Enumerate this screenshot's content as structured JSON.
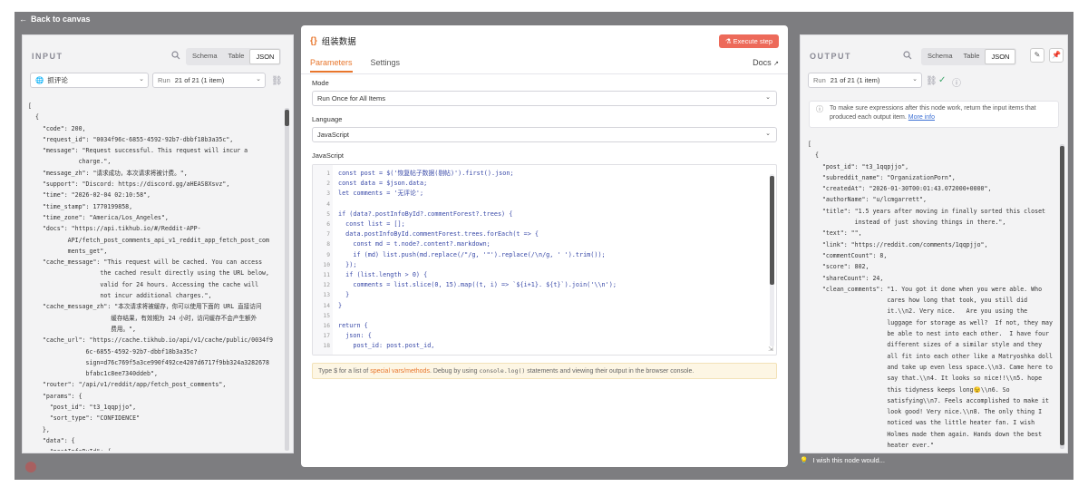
{
  "topbar": {
    "back_label": "Back to canvas",
    "back_icon": "arrow-left-icon"
  },
  "input_panel": {
    "header": "INPUT",
    "view_tabs": [
      "Schema",
      "Table",
      "JSON"
    ],
    "active_tab": "JSON",
    "node_select": "抓评论",
    "run_label": "Run",
    "run_select": "21 of 21 (1 item)",
    "code_lines": [
      "[",
      "  {",
      "    \"code\": 200,",
      "    \"request_id\": \"0034f96c-6855-4592-92b7-dbbf18b3a35c\",",
      "    \"message\": \"Request successful. This request will incur a",
      "              charge.\",",
      "    \"message_zh\": \"请求成功，本次请求将被计费。\",",
      "    \"support\": \"Discord: https://discord.gg/aHEAS8Xsvz\",",
      "    \"time\": \"2026-02-04 02:10:58\",",
      "    \"time_stamp\": 1770199858,",
      "    \"time_zone\": \"America/Los_Angeles\",",
      "    \"docs\": \"https://api.tikhub.io/#/Reddit-APP-",
      "           API/fetch_post_comments_api_v1_reddit_app_fetch_post_com",
      "           ments_get\",",
      "    \"cache_message\": \"This request will be cached. You can access",
      "                    the cached result directly using the URL below,",
      "                    valid for 24 hours. Accessing the cache will",
      "                    not incur additional charges.\",",
      "    \"cache_message_zh\": \"本次请求将被缓存，你可以使用下面的 URL 直接访问",
      "                       缓存结果，有效期为 24 小时，访问缓存不会产生额外",
      "                       费用。\",",
      "    \"cache_url\": \"https://cache.tikhub.io/api/v1/cache/public/0034f9",
      "                6c-6855-4592-92b7-dbbf18b3a35c?",
      "                sign=d76c769f5a3ce990f492ce4207d6717f9bb324a3282678",
      "                bfabc1c8ee7340ddeb\",",
      "    \"router\": \"/api/v1/reddit/app/fetch_post_comments\",",
      "    \"params\": {",
      "      \"post_id\": \"t3_1qqpjjo\",",
      "      \"sort_type\": \"CONFIDENCE\"",
      "    },",
      "    \"data\": {",
      "      \"postInfoById\": {"
    ]
  },
  "editor_panel": {
    "title": "组装数据",
    "execute_label": "Execute step",
    "tabs": [
      "Parameters",
      "Settings"
    ],
    "active_tab": "Parameters",
    "docs_label": "Docs",
    "mode_label": "Mode",
    "mode_value": "Run Once for All Items",
    "language_label": "Language",
    "language_value": "JavaScript",
    "code_label": "JavaScript",
    "line_numbers": [
      "1",
      "2",
      "3",
      "4",
      "5",
      "6",
      "7",
      "8",
      "9",
      "10",
      "11",
      "12",
      "13",
      "14",
      "15",
      "16",
      "17",
      "18"
    ],
    "code_lines": [
      "const post = $('恢复帖子数据(剔帖)').first().json;",
      "const data = $json.data;",
      "let comments = '无评论';",
      "",
      "if (data?.postInfoById?.commentForest?.trees) {",
      "  const list = [];",
      "  data.postInfoById.commentForest.trees.forEach(t => {",
      "    const md = t.node?.content?.markdown;",
      "    if (md) list.push(md.replace(/\"/g, '\"').replace(/\\n/g, ' ').trim());",
      "  });",
      "  if (list.length > 0) {",
      "    comments = list.slice(0, 15).map((t, i) => `${i+1}. ${t}`).join('\\\\n');",
      "  }",
      "}",
      "",
      "return {",
      "  json: {",
      "    post_id: post.post_id,"
    ],
    "hint_prefix": "Type $ for a list of ",
    "hint_link": "special vars/methods",
    "hint_mid": ". Debug by using ",
    "hint_code": "console.log()",
    "hint_suffix": " statements and viewing their output in the browser console."
  },
  "output_panel": {
    "header": "OUTPUT",
    "view_tabs": [
      "Schema",
      "Table",
      "JSON"
    ],
    "active_tab": "JSON",
    "run_label": "Run",
    "run_select": "21 of 21 (1 item)",
    "info_text": "To make sure expressions after this node work, return the input items that produced each output item.",
    "info_link": "More info",
    "code_lines": [
      "[",
      "  {",
      "    \"post_id\": \"t3_1qqpjjo\",",
      "    \"subreddit_name\": \"OrganizationPorn\",",
      "    \"createdAt\": \"2026-01-30T00:01:43.072000+0000\",",
      "    \"authorName\": \"u/lcmgarrett\",",
      "    \"title\": \"1.5 years after moving in finally sorted this closet",
      "             instead of just shoving things in there.\",",
      "    \"text\": \"\",",
      "    \"link\": \"https://reddit.com/comments/1qqpjjo\",",
      "    \"commentCount\": 8,",
      "    \"score\": 802,",
      "    \"shareCount\": 24,",
      "    \"clean_comments\": \"1. You got it done when you were able. Who",
      "                      cares how long that took, you still did",
      "                      it.\\\\n2. Very nice.   Are you using the",
      "                      luggage for storage as well?  If not, they may",
      "                      be able to nest into each other.  I have four",
      "                      different sizes of a similar style and they",
      "                      all fit into each other like a Matryoshka doll",
      "                      and take up even less space.\\\\n3. Came here to",
      "                      say that.\\\\n4. It looks so nice!!\\\\n5. hope",
      "                      this tidyness keeps long😉\\\\n6. So",
      "                      satisfying\\\\n7. Feels accomplished to make it",
      "                      look good! Very nice.\\\\n8. The only thing I",
      "                      noticed was the little heater fan. I wish",
      "                      Holmes made them again. Hands down the best",
      "                      heater ever.\""
    ]
  },
  "feedback": {
    "label": "I wish this node would..."
  }
}
